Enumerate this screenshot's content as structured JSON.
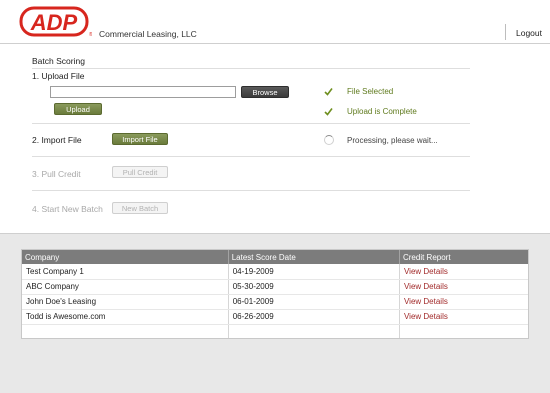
{
  "header": {
    "logo_text": "ADP",
    "company": "Commercial Leasing, LLC",
    "logout_label": "Logout"
  },
  "batch": {
    "title": "Batch Scoring",
    "steps": [
      {
        "label": "1. Upload File",
        "enabled": true
      },
      {
        "label": "2. Import File",
        "enabled": true
      },
      {
        "label": "3. Pull Credit",
        "enabled": false
      },
      {
        "label": "4. Start New Batch",
        "enabled": false
      }
    ],
    "file_input_value": "",
    "browse_label": "Browse",
    "upload_label": "Upload",
    "import_label": "Import File",
    "pull_credit_label": "Pull Credit",
    "new_batch_label": "New Batch",
    "status_file_selected": "File Selected",
    "status_upload_complete": "Upload is Complete",
    "status_processing": "Processing, please wait..."
  },
  "table": {
    "columns": [
      "Company",
      "Latest Score Date",
      "Credit Report"
    ],
    "rows": [
      {
        "company": "Test Company 1",
        "date": "04-19-2009",
        "report": "View Details"
      },
      {
        "company": "ABC Company",
        "date": "05-30-2009",
        "report": "View Details"
      },
      {
        "company": "John Doe's Leasing",
        "date": "06-01-2009",
        "report": "View Details"
      },
      {
        "company": "Todd is Awesome.com",
        "date": "06-26-2009",
        "report": "View Details"
      }
    ]
  },
  "colors": {
    "brand_red": "#d7261e",
    "accent_green": "#6a7b3b",
    "status_green": "#5f7a1d",
    "link_red": "#a22b2b",
    "header_gray": "#7c7c7c"
  }
}
